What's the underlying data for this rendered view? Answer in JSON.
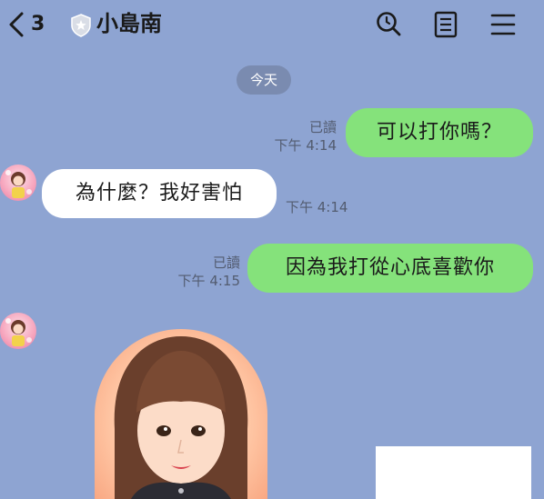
{
  "header": {
    "back_count": "3",
    "title": "小島南",
    "icons": [
      "search-icon",
      "note-icon",
      "menu-icon"
    ]
  },
  "date_separator": "今天",
  "messages": [
    {
      "direction": "out",
      "text": "可以打你嗎？",
      "read": "已讀",
      "time": "下午 4:14"
    },
    {
      "direction": "in",
      "text": "為什麼？我好害怕",
      "time": "下午 4:14"
    },
    {
      "direction": "out",
      "text": "因為我打從心底喜歡你",
      "read": "已讀",
      "time": "下午 4:15"
    }
  ],
  "colors": {
    "background": "#8ea4d2",
    "outgoing_bubble": "#85e27b",
    "incoming_bubble": "#ffffff",
    "date_pill": "#7a8bb0"
  }
}
